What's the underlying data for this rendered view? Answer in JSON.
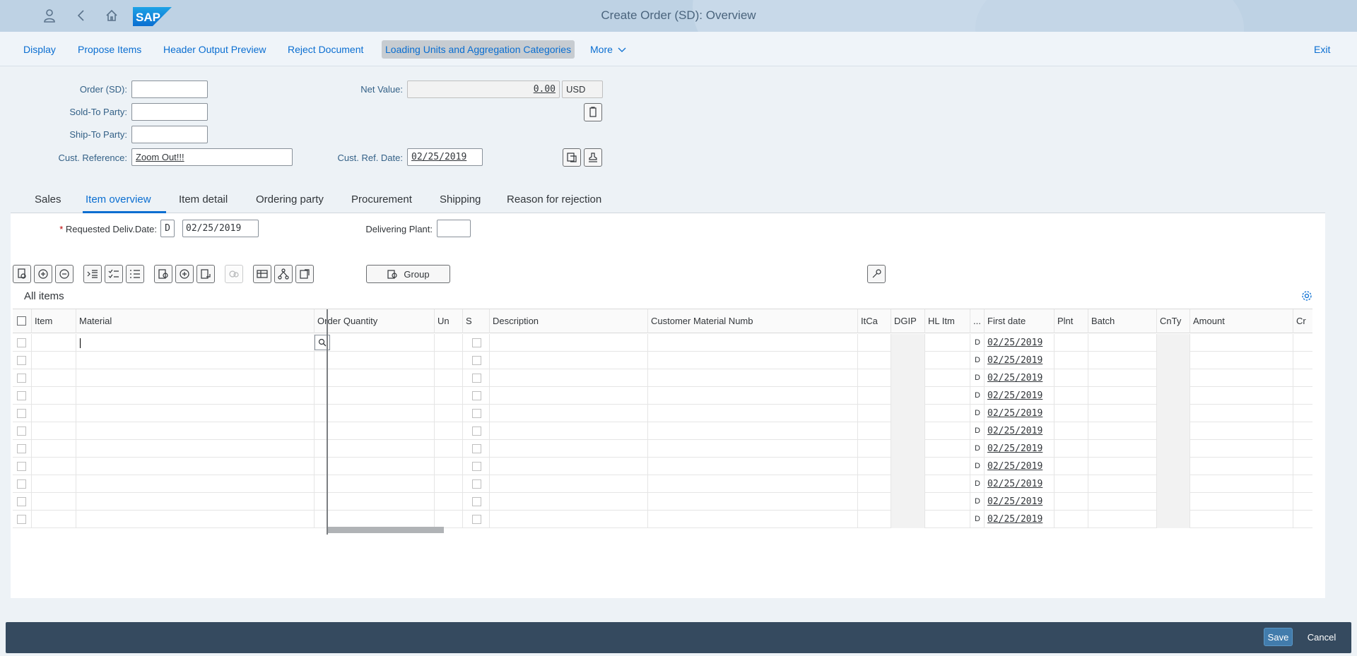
{
  "shell": {
    "title": "Create Order (SD): Overview",
    "icons": [
      "user-icon",
      "back-icon",
      "home-icon",
      "sap-logo"
    ]
  },
  "toolbar": {
    "display": "Display",
    "propose_items": "Propose Items",
    "header_output_preview": "Header Output Preview",
    "reject_document": "Reject Document",
    "loading_units": "Loading Units and Aggregation Categories",
    "more": "More",
    "exit": "Exit"
  },
  "header": {
    "order_label": "Order (SD):",
    "order_value": "",
    "net_value_label": "Net Value:",
    "net_value": "0.00",
    "currency": "USD",
    "sold_to_label": "Sold-To Party:",
    "sold_to_value": "",
    "ship_to_label": "Ship-To Party:",
    "ship_to_value": "",
    "cust_ref_label": "Cust. Reference:",
    "cust_ref_value": "Zoom Out!!!",
    "cust_ref_date_label": "Cust. Ref. Date:",
    "cust_ref_date_value": "02/25/2019"
  },
  "tabs": [
    {
      "label": "Sales"
    },
    {
      "label": "Item overview"
    },
    {
      "label": "Item detail"
    },
    {
      "label": "Ordering party"
    },
    {
      "label": "Procurement"
    },
    {
      "label": "Shipping"
    },
    {
      "label": "Reason for rejection"
    }
  ],
  "item_overview": {
    "req_deliv_label": "Requested Deliv.Date:",
    "req_deliv_unit": "D",
    "req_deliv_date": "02/25/2019",
    "delivering_plant_label": "Delivering Plant:",
    "delivering_plant_value": "",
    "group_button": "Group",
    "table_title": "All items"
  },
  "table": {
    "columns": [
      "Item",
      "Material",
      "Order Quantity",
      "Un",
      "S",
      "Description",
      "Customer Material Numb",
      "ItCa",
      "DGIP",
      "HL Itm",
      "...",
      "First date",
      "Plnt",
      "Batch",
      "CnTy",
      "Amount",
      "Cr"
    ],
    "rows": [
      {
        "date_type": "D",
        "first_date": "02/25/2019"
      },
      {
        "date_type": "D",
        "first_date": "02/25/2019"
      },
      {
        "date_type": "D",
        "first_date": "02/25/2019"
      },
      {
        "date_type": "D",
        "first_date": "02/25/2019"
      },
      {
        "date_type": "D",
        "first_date": "02/25/2019"
      },
      {
        "date_type": "D",
        "first_date": "02/25/2019"
      },
      {
        "date_type": "D",
        "first_date": "02/25/2019"
      },
      {
        "date_type": "D",
        "first_date": "02/25/2019"
      },
      {
        "date_type": "D",
        "first_date": "02/25/2019"
      },
      {
        "date_type": "D",
        "first_date": "02/25/2019"
      },
      {
        "date_type": "D",
        "first_date": "02/25/2019"
      }
    ]
  },
  "footer": {
    "save": "Save",
    "cancel": "Cancel"
  },
  "colors": {
    "shell_bg": "#bed2e4",
    "link_blue": "#0a6ed1",
    "label_blue": "#346187",
    "footer_bg": "#354a5f",
    "save_bg": "#427cac"
  }
}
